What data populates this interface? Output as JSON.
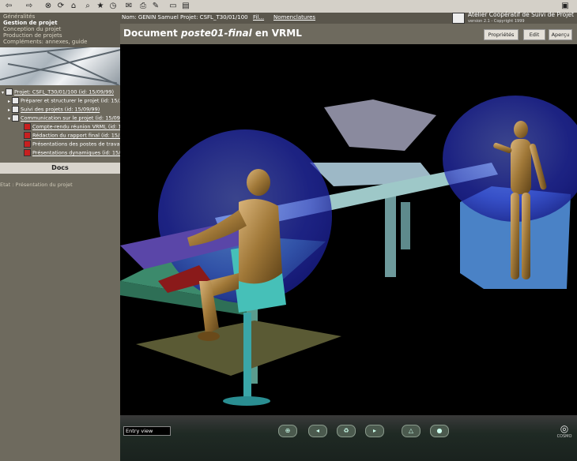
{
  "toolbar": {
    "icons": [
      "back-icon",
      "forward-icon",
      "stop-icon",
      "refresh-icon",
      "home-icon",
      "search-icon",
      "favorites-icon",
      "history-icon",
      "mail-icon",
      "print-icon",
      "edit-icon",
      "discuss-icon"
    ]
  },
  "sidebar": {
    "menu": [
      "Généralités",
      "Gestion de projet",
      "Conception du projet",
      "Production de projets",
      "Compléments: annexes, guide"
    ],
    "tree": [
      {
        "label": "Projet: CSFL_T30/01/100 (id: 15/09/99)",
        "indent": 0,
        "icon": "folder",
        "link": true
      },
      {
        "label": "Préparer et structurer le projet (id: 15/...)",
        "indent": 1,
        "icon": "doc",
        "link": false
      },
      {
        "label": "Suivi des projets (id: 15/09/99)",
        "indent": 1,
        "icon": "doc",
        "link": true
      },
      {
        "label": "Communication sur le projet (id: 15/09/...)",
        "indent": 1,
        "icon": "doc",
        "link": true
      },
      {
        "label": "Compte-rendu réunion VRML (id: 15/...)",
        "indent": 2,
        "icon": "red",
        "link": true
      },
      {
        "label": "Rédaction du rapport final (id: 15/...)",
        "indent": 2,
        "icon": "red",
        "link": true
      },
      {
        "label": "Présentations des postes de travail (id: ...)",
        "indent": 2,
        "icon": "red",
        "link": false
      },
      {
        "label": "Présentations dynamiques (id: 15/...)",
        "indent": 2,
        "icon": "red",
        "link": true
      }
    ],
    "docs_label": "Docs",
    "status": "Etat : Présentation du projet"
  },
  "header": {
    "nom": "Nom: GENIN Samuel",
    "projet": "Projet: CSFL_T30/01/100",
    "links": [
      "Fil...",
      "Nomenclatures"
    ],
    "brand_line1": "Atelier Coopératif de Suivi de Projet",
    "brand_line2": "version 2.1 - Copyright 1999"
  },
  "document": {
    "title_prefix": "Document",
    "title_name": "poste01-final",
    "title_suffix": "en VRML",
    "buttons": [
      "Propriétés",
      "Edit",
      "Aperçu"
    ]
  },
  "viewer": {
    "viewpoint": "Entry view",
    "brand": "COSMO"
  }
}
